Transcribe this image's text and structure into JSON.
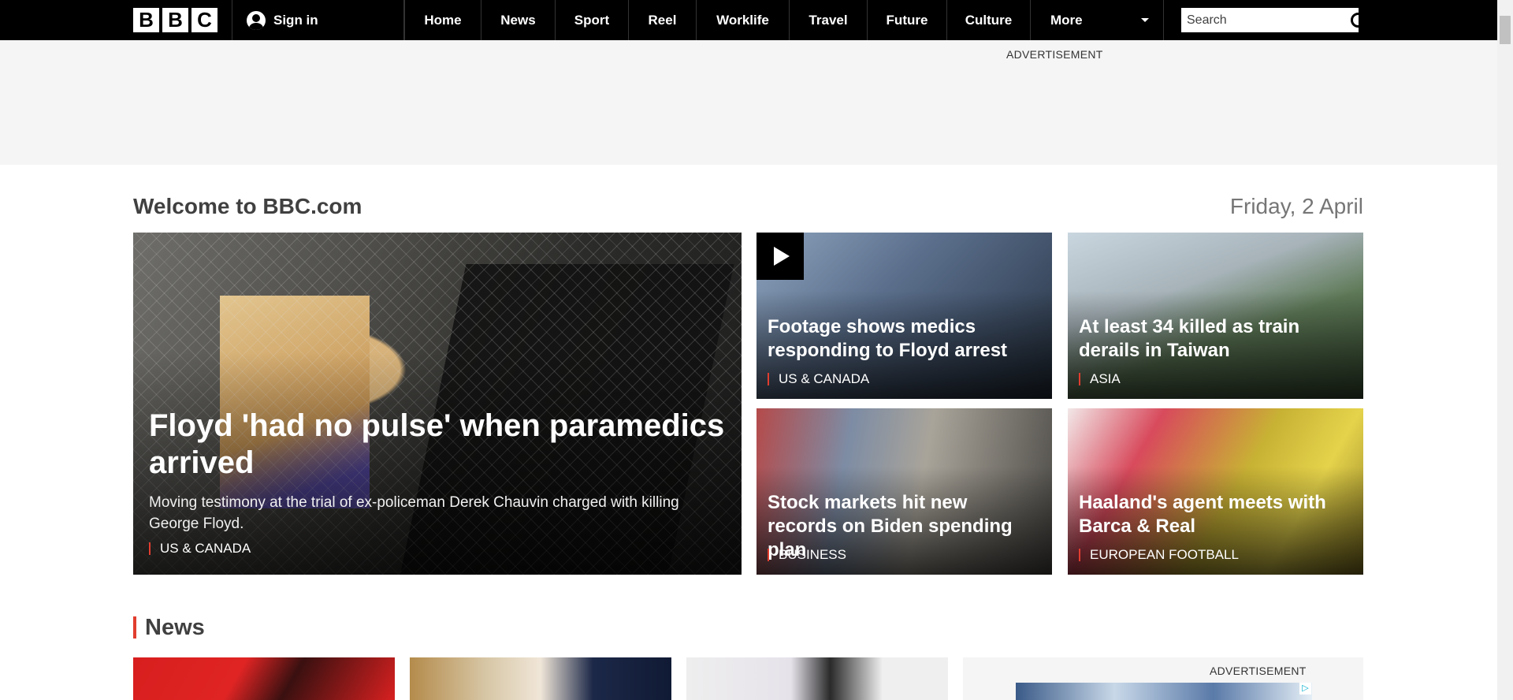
{
  "nav": {
    "logo_letters": [
      "B",
      "B",
      "C"
    ],
    "signin_label": "Sign in",
    "items": [
      "Home",
      "News",
      "Sport",
      "Reel",
      "Worklife",
      "Travel",
      "Future",
      "Culture"
    ],
    "more_label": "More",
    "search_placeholder": "Search"
  },
  "ads": {
    "top_label": "ADVERTISEMENT",
    "side_label": "ADVERTISEMENT"
  },
  "welcome": {
    "title": "Welcome to BBC.com",
    "date": "Friday, 2 April"
  },
  "hero": {
    "main": {
      "title": "Floyd 'had no pulse' when paramedics arrived",
      "summary": "Moving testimony at the trial of ex-policeman Derek Chauvin charged with killing George Floyd.",
      "tag": "US & CANADA"
    },
    "stories": [
      {
        "title": "Footage shows medics responding to Floyd arrest",
        "tag": "US & CANADA",
        "video": true
      },
      {
        "title": "At least 34 killed as train derails in Taiwan",
        "tag": "ASIA",
        "video": false
      },
      {
        "title": "Stock markets hit new records on Biden spending plan",
        "tag": "BUSINESS",
        "video": false
      },
      {
        "title": "Haaland's agent meets with Barca & Real",
        "tag": "EUROPEAN FOOTBALL",
        "video": false
      }
    ]
  },
  "news": {
    "heading": "News"
  },
  "colors": {
    "accent": "#e13d2f",
    "nav_bg": "#000000",
    "ad_bg": "#f5f5f5"
  }
}
